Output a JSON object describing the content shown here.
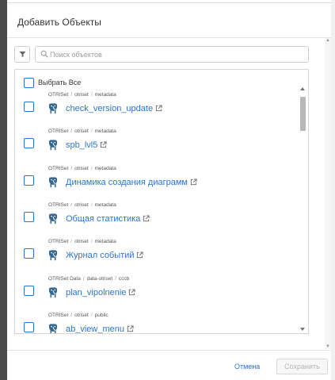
{
  "dialog": {
    "title": "Добавить Объекты"
  },
  "search": {
    "placeholder": "Поиск объектов",
    "value": ""
  },
  "list": {
    "select_all_label": "Выбрать Все",
    "items": [
      {
        "path": [
          "OTRISet",
          "otriset",
          "metadata"
        ],
        "name": "check_version_update",
        "checked": false,
        "icon": "postgresql-elephant-icon"
      },
      {
        "path": [
          "OTRISet",
          "otriset",
          "metadata"
        ],
        "name": "spb_lvl5",
        "checked": false,
        "icon": "postgresql-elephant-icon"
      },
      {
        "path": [
          "OTRISet",
          "otriset",
          "metadata"
        ],
        "name": "Динамика создания диаграмм",
        "checked": false,
        "icon": "postgresql-elephant-icon"
      },
      {
        "path": [
          "OTRISet",
          "otriset",
          "metadata"
        ],
        "name": "Общая статистика",
        "checked": false,
        "icon": "postgresql-elephant-icon"
      },
      {
        "path": [
          "OTRISet",
          "otriset",
          "metadata"
        ],
        "name": "Журнал событий",
        "checked": false,
        "icon": "postgresql-elephant-icon"
      },
      {
        "path": [
          "OTRISet Data",
          "data-otriset",
          "cccb"
        ],
        "name": "plan_vipolnenie",
        "checked": false,
        "icon": "postgresql-elephant-icon"
      },
      {
        "path": [
          "OTRISet",
          "otriset",
          "public"
        ],
        "name": "ab_view_menu",
        "checked": false,
        "icon": "postgresql-elephant-icon"
      }
    ]
  },
  "footer": {
    "cancel_label": "Отмена",
    "save_label": "Сохранить"
  },
  "colors": {
    "accent": "#2a74cc",
    "icon_blue": "#336791"
  }
}
